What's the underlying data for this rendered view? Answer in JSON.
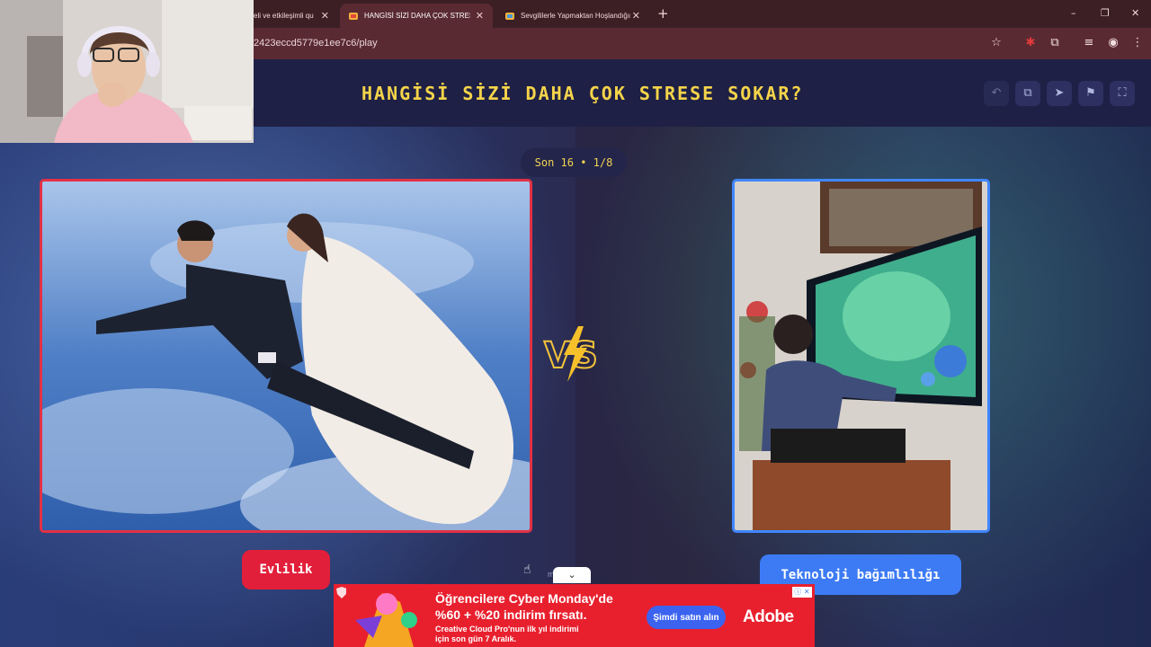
{
  "browser": {
    "tabs": [
      {
        "label": "eli ve etkileşimli qu",
        "active": false
      },
      {
        "label": "HANGİSİ SİZİ DAHA ÇOK STRESE S",
        "active": true
      },
      {
        "label": "Sevgililerle Yapmaktan Hoşlandığın",
        "active": false
      }
    ],
    "close_glyph": "✕",
    "new_tab_glyph": "+",
    "url": "2423eccd5779e1ee7c6/play",
    "window_controls": {
      "minimize": "–",
      "maximize": "❐",
      "close": "✕"
    }
  },
  "game": {
    "title": "HANGİSİ SİZİ DAHA ÇOK STRESE SOKAR?",
    "round_label": "Son 16 • 1/8",
    "left_choice": {
      "label": "Evlilik",
      "accent": "#e21f3a"
    },
    "right_choice": {
      "label": "Teknoloji bağımlılığı",
      "accent": "#3d7bf5"
    },
    "toolbar_icons": [
      "undo-icon",
      "share-icon",
      "send-icon",
      "flag-icon",
      "fullscreen-icon"
    ],
    "collapse_glyph": "⌄",
    "faint_text": "m          h"
  },
  "ad": {
    "line1": "Öğrencilere Cyber Monday'de",
    "line2": "%60 + %20 indirim fırsatı.",
    "line3": "Creative Cloud Pro'nun ilk yıl indirimi",
    "line4": "için son gün 7 Aralık.",
    "cta": "Şimdi satın alın",
    "brand": "Adobe",
    "info_glyph": "ⓘ ✕"
  },
  "colors": {
    "title_yellow": "#f5d44a",
    "tabbar": "#3b1f24",
    "addressbar": "#5a2a32",
    "ad_red": "#e8202e"
  }
}
